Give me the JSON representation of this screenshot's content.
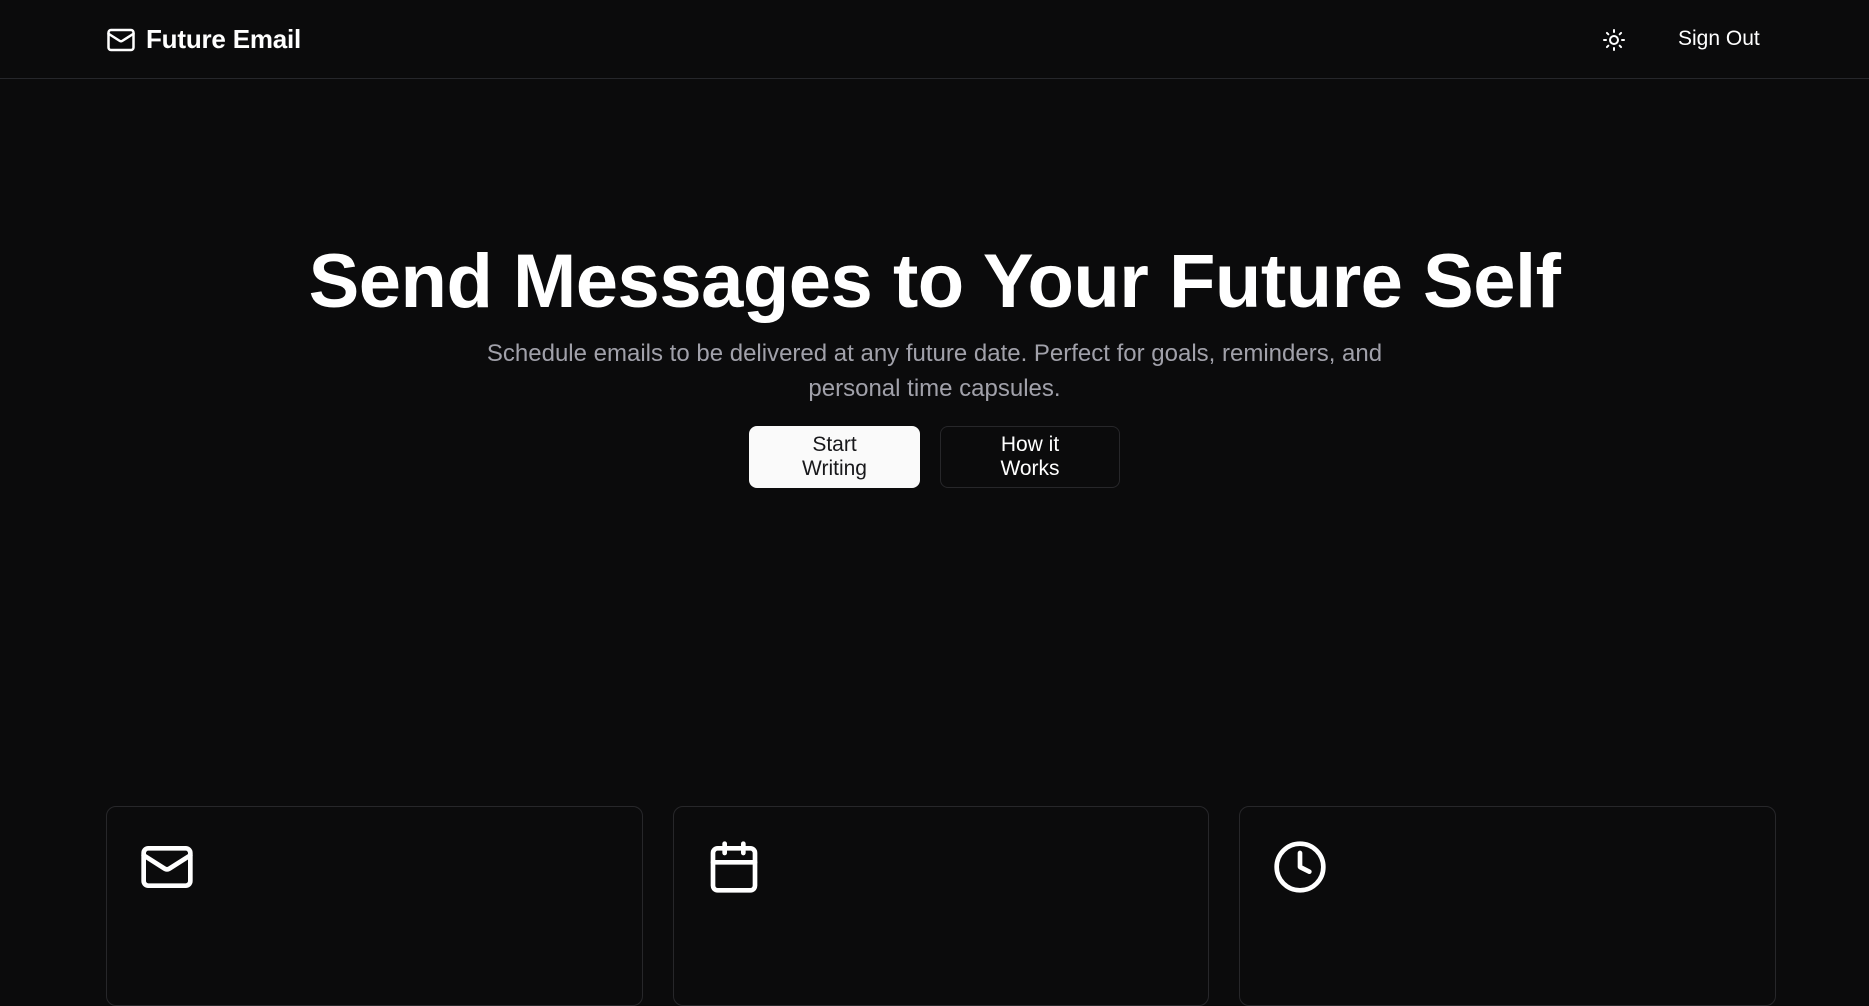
{
  "nav": {
    "brand_name": "Future Email",
    "brand_icon": "mail-icon",
    "theme_toggle_icon": "sun-icon",
    "signout_label": "Sign Out"
  },
  "hero": {
    "title": "Send Messages to Your Future Self",
    "subtitle": "Schedule emails to be delivered at any future date. Perfect for goals, reminders, and personal time capsules.",
    "primary_cta": "Start Writing",
    "secondary_cta": "How it Works"
  },
  "features": {
    "cards": [
      {
        "icon": "mail-icon"
      },
      {
        "icon": "calendar-icon"
      },
      {
        "icon": "clock-icon"
      }
    ]
  },
  "colors": {
    "background": "#0b0b0c",
    "border": "#27272a",
    "muted_text": "#a1a1aa",
    "primary_button_bg": "#fafafa",
    "primary_button_text": "#18181b"
  }
}
